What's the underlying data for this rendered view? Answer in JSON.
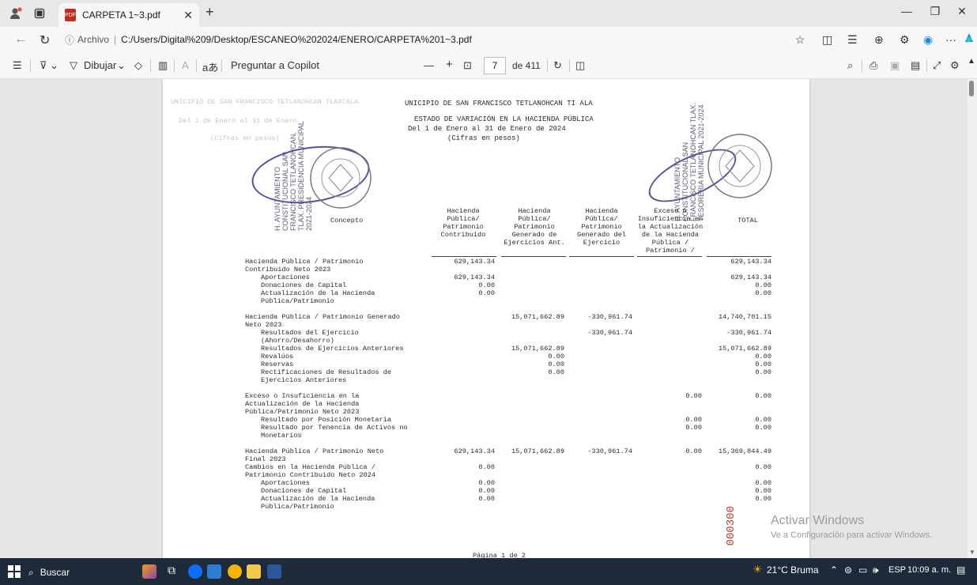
{
  "tab": {
    "title": "CARPETA 1~3.pdf"
  },
  "address": {
    "info": "Archivo",
    "url": "C:/Users/Digital%209/Desktop/ESCANEO%202024/ENERO/CARPETA%201~3.pdf"
  },
  "toolbar": {
    "draw_label": "Dibujar",
    "text_icon": "aあ",
    "copilot_label": "Preguntar a Copilot",
    "minus": "—",
    "plus": "+",
    "page_number": "7",
    "page_total": "de 411"
  },
  "document": {
    "header_line": "UNICIPIO DE SAN FRANCISCO TETLANOHCAN TI    ALA",
    "report_title": "ESTADO DE VARIACIÓN EN LA HACIENDA PÚBLICA",
    "period": "Del 1 de Enero al 31 de Enero de 2024",
    "units": "(Cifras en pesos)",
    "ghost_header": "UNICIPIO DE SAN FRANCISCO TETLANOHCAN TLAXCALA",
    "ghost_period": "Del 1 de Enero al 31 de Enero",
    "ghost_units": "(Cifras en pesos)",
    "seal_left_text": "H. AYUNTAMIENTO CONSTITUCIONAL SAN FRANCISCO TETLANOHCAN, TLAX. PRESIDENCIA MUNICIPAL 2021-2024",
    "seal_right_text": "H. AYUNTAMIENTO CONSTITUCIONAL SAN FRANCISCO TETLANOHCAN TLAX. TESORERIA MUNICIPAL 2021-2024",
    "columns": {
      "concepto": "Concepto",
      "c1": "Hacienda Pública/ Patrimonio Contribuido",
      "c2": "Hacienda Pública/ Patrimonio Generado de Ejercicios Ant.",
      "c3": "Hacienda Pública/ Patrimonio Generado del Ejercicio",
      "c4": "Exceso o Insuficiencia en la Actualización de la Hacienda Pública / Patrimonio /",
      "c5": "TOTAL"
    },
    "rows": [
      {
        "concept": "Hacienda Pública / Patrimonio",
        "c1": "629,143.34",
        "c2": "",
        "c3": "",
        "c4": "",
        "total": "629,143.34",
        "indent": 0
      },
      {
        "concept": "Contribuido Neto 2023",
        "c1": "",
        "c2": "",
        "c3": "",
        "c4": "",
        "total": "",
        "indent": 0
      },
      {
        "concept": "Aportaciones",
        "c1": "629,143.34",
        "c2": "",
        "c3": "",
        "c4": "",
        "total": "629,143.34",
        "indent": 1
      },
      {
        "concept": "Donaciones de Capital",
        "c1": "0.00",
        "c2": "",
        "c3": "",
        "c4": "",
        "total": "0.00",
        "indent": 1
      },
      {
        "concept": "Actualización de la Hacienda",
        "c1": "0.00",
        "c2": "",
        "c3": "",
        "c4": "",
        "total": "0.00",
        "indent": 1
      },
      {
        "concept": "Pública/Patrimonio",
        "c1": "",
        "c2": "",
        "c3": "",
        "c4": "",
        "total": "",
        "indent": 1
      },
      {
        "concept": "",
        "c1": "",
        "c2": "",
        "c3": "",
        "c4": "",
        "total": "",
        "indent": 0
      },
      {
        "concept": "Hacienda Pública / Patrimonio Generado",
        "c1": "",
        "c2": "15,071,662.89",
        "c3": "-330,961.74",
        "c4": "",
        "total": "14,740,701.15",
        "indent": 0
      },
      {
        "concept": "Neto 2023",
        "c1": "",
        "c2": "",
        "c3": "",
        "c4": "",
        "total": "",
        "indent": 0
      },
      {
        "concept": "Resultados del Ejercicio",
        "c1": "",
        "c2": "",
        "c3": "-330,961.74",
        "c4": "",
        "total": "-330,961.74",
        "indent": 1
      },
      {
        "concept": "(Ahorro/Desahorro)",
        "c1": "",
        "c2": "",
        "c3": "",
        "c4": "",
        "total": "",
        "indent": 1
      },
      {
        "concept": "Resultados de Ejercicios Anteriores",
        "c1": "",
        "c2": "15,071,662.89",
        "c3": "",
        "c4": "",
        "total": "15,071,662.89",
        "indent": 1
      },
      {
        "concept": "Revalúos",
        "c1": "",
        "c2": "0.00",
        "c3": "",
        "c4": "",
        "total": "0.00",
        "indent": 1
      },
      {
        "concept": "Reservas",
        "c1": "",
        "c2": "0.00",
        "c3": "",
        "c4": "",
        "total": "0.00",
        "indent": 1
      },
      {
        "concept": "Rectificaciones de Resultados de",
        "c1": "",
        "c2": "0.00",
        "c3": "",
        "c4": "",
        "total": "0.00",
        "indent": 1
      },
      {
        "concept": "Ejercicios Anteriores",
        "c1": "",
        "c2": "",
        "c3": "",
        "c4": "",
        "total": "",
        "indent": 1
      },
      {
        "concept": "",
        "c1": "",
        "c2": "",
        "c3": "",
        "c4": "",
        "total": "",
        "indent": 0
      },
      {
        "concept": "Exceso o Insuficiencia en la",
        "c1": "",
        "c2": "",
        "c3": "",
        "c4": "0.00",
        "total": "0.00",
        "indent": 0
      },
      {
        "concept": "Actualización de la Hacienda",
        "c1": "",
        "c2": "",
        "c3": "",
        "c4": "",
        "total": "",
        "indent": 0
      },
      {
        "concept": "Pública/Patrimonio Neto 2023",
        "c1": "",
        "c2": "",
        "c3": "",
        "c4": "",
        "total": "",
        "indent": 0
      },
      {
        "concept": "Resultado por Posición Monetaria",
        "c1": "",
        "c2": "",
        "c3": "",
        "c4": "0.00",
        "total": "0.00",
        "indent": 1
      },
      {
        "concept": "Resultado por Tenencia de Activos no",
        "c1": "",
        "c2": "",
        "c3": "",
        "c4": "0.00",
        "total": "0.00",
        "indent": 1
      },
      {
        "concept": "Monetarios",
        "c1": "",
        "c2": "",
        "c3": "",
        "c4": "",
        "total": "",
        "indent": 1
      },
      {
        "concept": "",
        "c1": "",
        "c2": "",
        "c3": "",
        "c4": "",
        "total": "",
        "indent": 0
      },
      {
        "concept": "Hacienda Pública / Patrimonio Neto",
        "c1": "629,143.34",
        "c2": "15,071,662.89",
        "c3": "-330,961.74",
        "c4": "0.00",
        "total": "15,369,844.49",
        "indent": 0
      },
      {
        "concept": "Final 2023",
        "c1": "",
        "c2": "",
        "c3": "",
        "c4": "",
        "total": "",
        "indent": 0
      },
      {
        "concept": "Cambios en la Hacienda Pública /",
        "c1": "0.00",
        "c2": "",
        "c3": "",
        "c4": "",
        "total": "0.00",
        "indent": 0
      },
      {
        "concept": "Patrimonio Contribuido Neto 2024",
        "c1": "",
        "c2": "",
        "c3": "",
        "c4": "",
        "total": "",
        "indent": 0
      },
      {
        "concept": "Aportaciones",
        "c1": "0.00",
        "c2": "",
        "c3": "",
        "c4": "",
        "total": "0.00",
        "indent": 1
      },
      {
        "concept": "Donaciones de Capital",
        "c1": "0.00",
        "c2": "",
        "c3": "",
        "c4": "",
        "total": "0.00",
        "indent": 1
      },
      {
        "concept": "Actualización de la Hacienda",
        "c1": "0.00",
        "c2": "",
        "c3": "",
        "c4": "",
        "total": "0.00",
        "indent": 1
      },
      {
        "concept": "Pública/Patrimonio",
        "c1": "",
        "c2": "",
        "c3": "",
        "c4": "",
        "total": "",
        "indent": 1
      }
    ],
    "folio": "000300",
    "page_footer": "Página 1 de 2"
  },
  "watermark": {
    "title": "Activar Windows",
    "subtitle": "Ve a Configuración para activar Windows."
  },
  "taskbar": {
    "search_label": "Buscar",
    "weather": "21°C Bruma",
    "language": "ESP",
    "time": "10:09 a. m."
  },
  "colors": {
    "stamp_purple": "#5a4e9e",
    "folio_red": "#c0392b",
    "edge_logo": "#1e88e5"
  }
}
